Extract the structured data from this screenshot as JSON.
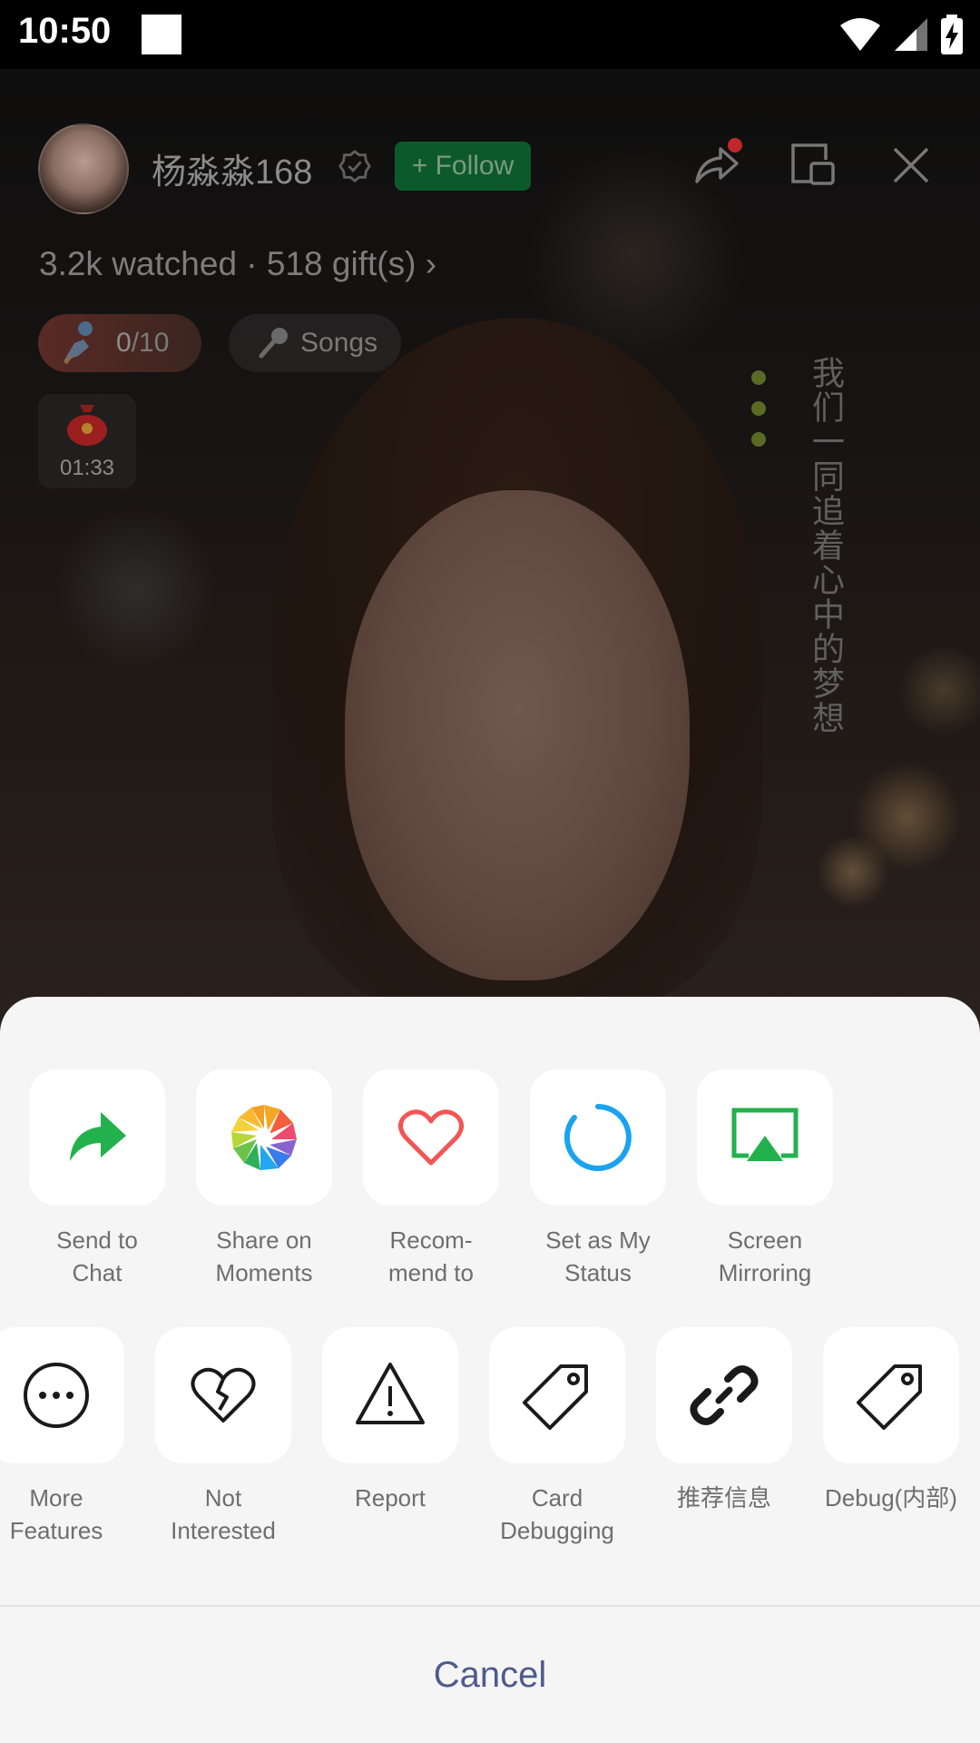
{
  "status_bar": {
    "time": "10:50"
  },
  "live": {
    "streamer_name": "杨淼淼168",
    "follow_label": "+ Follow",
    "stats_line": "3.2k watched · 518 gift(s)",
    "stats_chevron": "›",
    "quest": {
      "current": "0",
      "total": "/10",
      "progress": 0
    },
    "songs_label": "Songs",
    "redpack_timer": "01:33",
    "vertical_lyric": "我们一同追着心中的梦想"
  },
  "share_sheet": {
    "row1": [
      {
        "label": "Send to\nChat",
        "icon": "share-arrow-icon",
        "color": "#22b14c"
      },
      {
        "label": "Share on\nMoments",
        "icon": "moments-aperture-icon"
      },
      {
        "label": "Recom-\nmend to",
        "icon": "heart-icon",
        "color": "#f25555"
      },
      {
        "label": "Set as My\nStatus",
        "icon": "status-circle-icon",
        "color": "#1aa3f0"
      },
      {
        "label": "Screen\nMirroring",
        "icon": "screen-mirror-icon",
        "color": "#22b14c"
      }
    ],
    "row2": [
      {
        "label": "More\nFeatures",
        "icon": "more-dots-icon"
      },
      {
        "label": "Not\nInterested",
        "icon": "broken-heart-icon"
      },
      {
        "label": "Report",
        "icon": "warning-triangle-icon"
      },
      {
        "label": "Card\nDebugging",
        "icon": "tag-icon"
      },
      {
        "label": "推荐信息",
        "icon": "link-icon"
      },
      {
        "label": "Debug(内部)",
        "icon": "tag-icon"
      }
    ],
    "cancel_label": "Cancel"
  },
  "colors": {
    "follow_bg": "#0c5a2a",
    "accent_green": "#22b14c",
    "cancel_text": "#4e5b8c"
  }
}
